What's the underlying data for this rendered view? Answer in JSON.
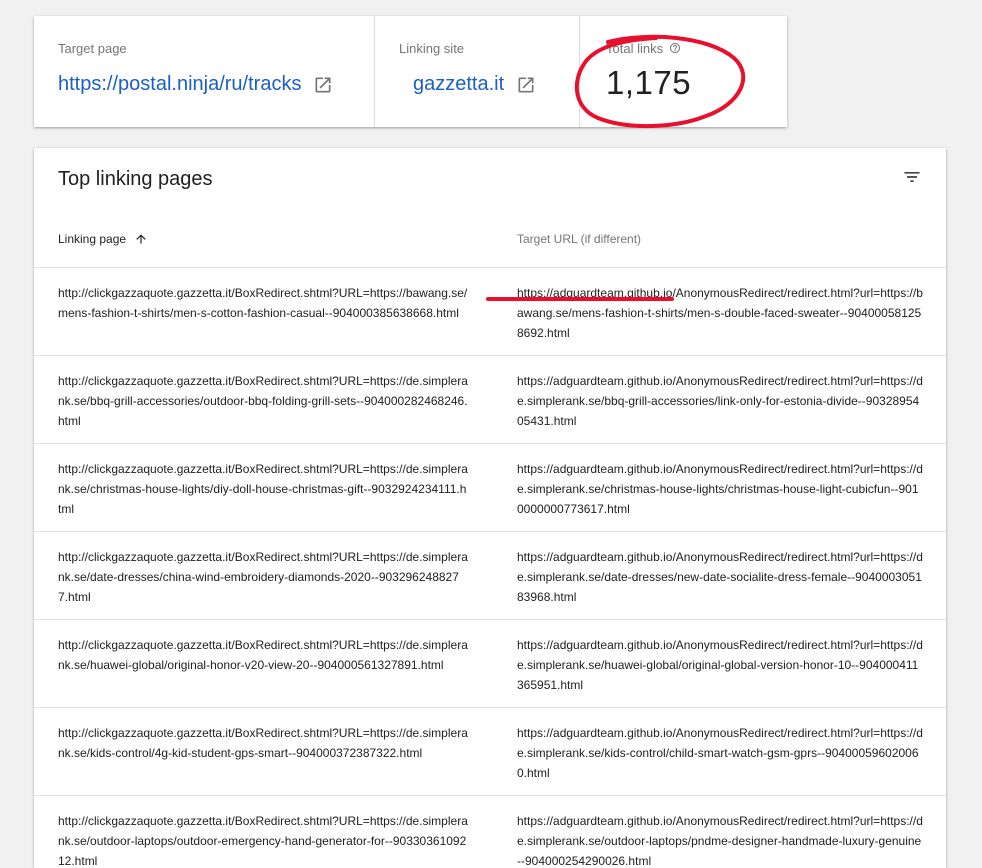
{
  "summary": {
    "target_label": "Target page",
    "target_url": "https://postal.ninja/ru/tracks",
    "site_label": "Linking site",
    "site_name": "gazzetta.it",
    "total_label": "Total links",
    "total_value": "1,175"
  },
  "table": {
    "title": "Top linking pages",
    "col_linking": "Linking page",
    "col_target": "Target URL (if different)",
    "rows": [
      {
        "linking": "http://clickgazzaquote.gazzetta.it/BoxRedirect.shtml?URL=https://bawang.se/mens-fashion-t-shirts/men-s-cotton-fashion-casual--904000385638668.html",
        "target": "https://adguardteam.github.io/AnonymousRedirect/redirect.html?url=https://bawang.se/mens-fashion-t-shirts/men-s-double-faced-sweater--904000581258692.html"
      },
      {
        "linking": "http://clickgazzaquote.gazzetta.it/BoxRedirect.shtml?URL=https://de.simplerank.se/bbq-grill-accessories/outdoor-bbq-folding-grill-sets--904000282468246.html",
        "target": "https://adguardteam.github.io/AnonymousRedirect/redirect.html?url=https://de.simplerank.se/bbq-grill-accessories/link-only-for-estonia-divide--9032895405431.html"
      },
      {
        "linking": "http://clickgazzaquote.gazzetta.it/BoxRedirect.shtml?URL=https://de.simplerank.se/christmas-house-lights/diy-doll-house-christmas-gift--9032924234111.html",
        "target": "https://adguardteam.github.io/AnonymousRedirect/redirect.html?url=https://de.simplerank.se/christmas-house-lights/christmas-house-light-cubicfun--9010000000773617.html"
      },
      {
        "linking": "http://clickgazzaquote.gazzetta.it/BoxRedirect.shtml?URL=https://de.simplerank.se/date-dresses/china-wind-embroidery-diamonds-2020--9032962488277.html",
        "target": "https://adguardteam.github.io/AnonymousRedirect/redirect.html?url=https://de.simplerank.se/date-dresses/new-date-socialite-dress-female--904000305183968.html"
      },
      {
        "linking": "http://clickgazzaquote.gazzetta.it/BoxRedirect.shtml?URL=https://de.simplerank.se/huawei-global/original-honor-v20-view-20--904000561327891.html",
        "target": "https://adguardteam.github.io/AnonymousRedirect/redirect.html?url=https://de.simplerank.se/huawei-global/original-global-version-honor-10--904000411365951.html"
      },
      {
        "linking": "http://clickgazzaquote.gazzetta.it/BoxRedirect.shtml?URL=https://de.simplerank.se/kids-control/4g-kid-student-gps-smart--904000372387322.html",
        "target": "https://adguardteam.github.io/AnonymousRedirect/redirect.html?url=https://de.simplerank.se/kids-control/child-smart-watch-gsm-gprs--904000596020060.html"
      },
      {
        "linking": "http://clickgazzaquote.gazzetta.it/BoxRedirect.shtml?URL=https://de.simplerank.se/outdoor-laptops/outdoor-emergency-hand-generator-for--9033036109212.html",
        "target": "https://adguardteam.github.io/AnonymousRedirect/redirect.html?url=https://de.simplerank.se/outdoor-laptops/pndme-designer-handmade-luxury-genuine--904000254290026.html"
      }
    ]
  },
  "colors": {
    "link": "#1a5fc8",
    "annotation": "#e8112d"
  },
  "icons": [
    "open-in-new-icon",
    "help-circle-icon",
    "arrow-up-icon",
    "filter-list-icon"
  ]
}
